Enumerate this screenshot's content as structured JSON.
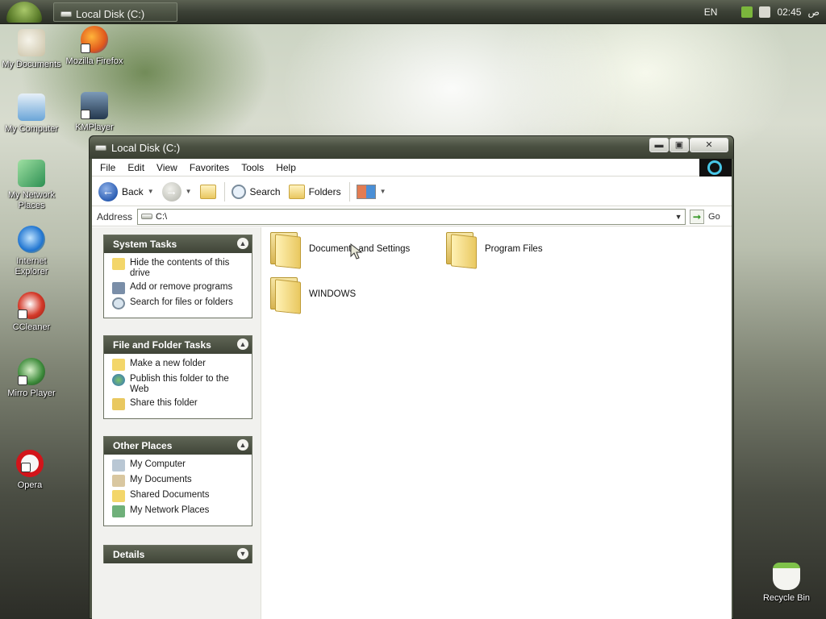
{
  "taskbar": {
    "window_button": "Local Disk (C:)",
    "language": "EN",
    "clock": "02:45",
    "ampm": "ص"
  },
  "desktop_icons": [
    {
      "label": "My Documents",
      "icon": "my-documents-icon"
    },
    {
      "label": "Mozilla Firefox",
      "icon": "firefox-icon"
    },
    {
      "label": "My Computer",
      "icon": "my-computer-icon"
    },
    {
      "label": "KMPlayer",
      "icon": "kmplayer-icon"
    },
    {
      "label": "My Network Places",
      "icon": "network-places-icon"
    },
    {
      "label": "Internet Explorer",
      "icon": "internet-explorer-icon"
    },
    {
      "label": "CCleaner",
      "icon": "ccleaner-icon"
    },
    {
      "label": "Mirro Player",
      "icon": "mirro-player-icon"
    },
    {
      "label": "Opera",
      "icon": "opera-icon"
    },
    {
      "label": "Recycle Bin",
      "icon": "recycle-bin-icon"
    }
  ],
  "window": {
    "title": "Local Disk (C:)",
    "menu": [
      "File",
      "Edit",
      "View",
      "Favorites",
      "Tools",
      "Help"
    ],
    "toolbar": {
      "back": "Back",
      "search": "Search",
      "folders": "Folders"
    },
    "address": {
      "label": "Address",
      "value": "C:\\",
      "go": "Go"
    },
    "task_pane": {
      "system_tasks": {
        "title": "System Tasks",
        "items": [
          "Hide the contents of this drive",
          "Add or remove programs",
          "Search for files or folders"
        ]
      },
      "file_folder_tasks": {
        "title": "File and Folder Tasks",
        "items": [
          "Make a new folder",
          "Publish this folder to the Web",
          "Share this folder"
        ]
      },
      "other_places": {
        "title": "Other Places",
        "items": [
          "My Computer",
          "My Documents",
          "Shared Documents",
          "My Network Places"
        ]
      },
      "details": {
        "title": "Details"
      }
    },
    "files": [
      {
        "name": "Documents and Settings"
      },
      {
        "name": "Program Files"
      },
      {
        "name": "WINDOWS"
      }
    ]
  }
}
